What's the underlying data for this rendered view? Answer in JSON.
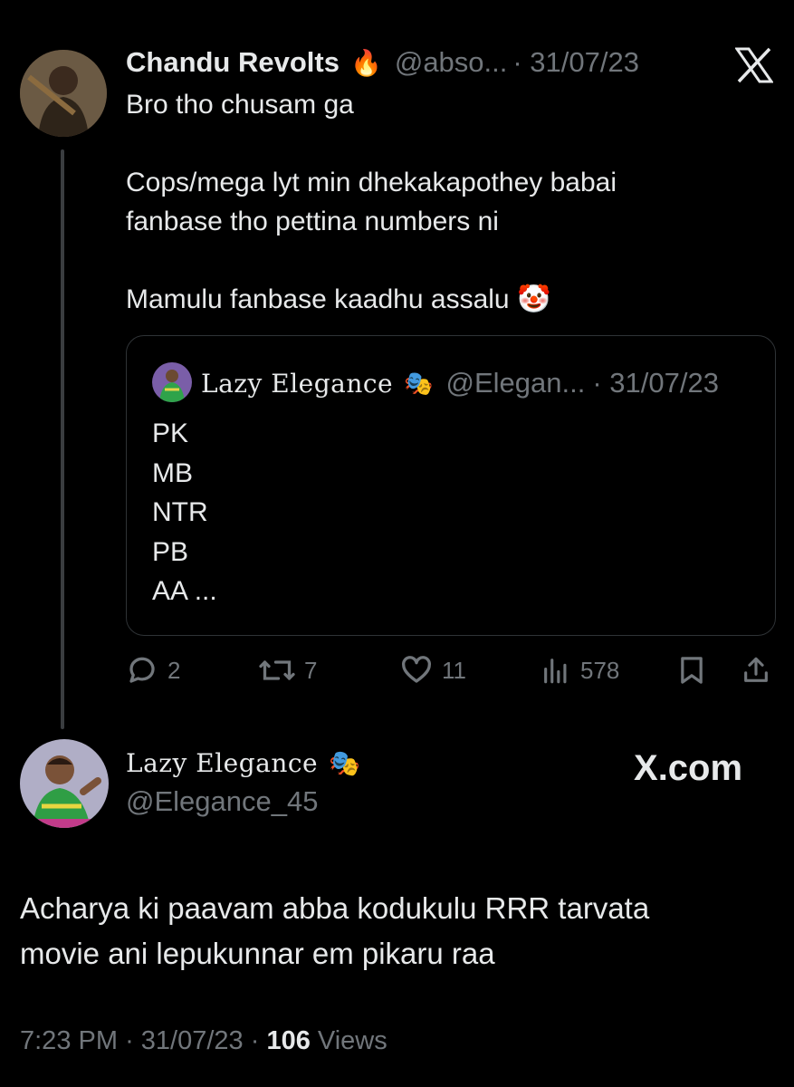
{
  "tweet": {
    "author_name": "Chandu Revolts",
    "author_emoji": "🔥",
    "author_handle": "@abso...",
    "date": "· 31/07/23",
    "text": "Bro tho chusam ga\n\nCops/mega lyt min dhekakapothey babai\nfanbase tho pettina numbers ni\n\nMamulu fanbase kaadhu assalu 🤡",
    "quote": {
      "author_name": "Lazy Elegance",
      "author_emoji": "🎭",
      "author_handle": "@Elegan...",
      "date": "· 31/07/23",
      "text": "PK\nMB\nNTR\nPB\nAA ..."
    },
    "actions": {
      "replies": "2",
      "retweets": "7",
      "likes": "11",
      "views": "578"
    }
  },
  "reply": {
    "author_name": "Lazy Elegance",
    "author_emoji": "🎭",
    "author_handle": "@Elegance_45",
    "text": "Acharya ki paavam abba kodukulu RRR tarvata\nmovie ani lepukunnar em pikaru raa",
    "time": "7:23 PM",
    "date": "31/07/23",
    "views_count": "106",
    "views_label": "Views"
  },
  "watermark": {
    "logo": "X",
    "brand": ".com"
  },
  "colors": {
    "background": "#000000",
    "text": "#e7e9ea",
    "muted": "#71767b",
    "border": "#2f3336"
  }
}
